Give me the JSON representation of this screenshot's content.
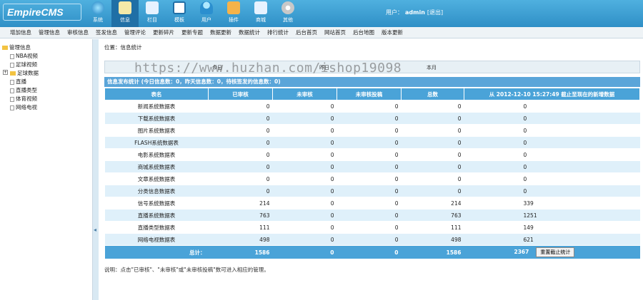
{
  "app": {
    "logo": "EmpireCMS"
  },
  "nav": [
    {
      "label": "系统",
      "icon": "globe-icon",
      "color": "#6fd0ff"
    },
    {
      "label": "信息",
      "icon": "document-edit-icon",
      "color": "#f5e9a8"
    },
    {
      "label": "栏目",
      "icon": "folder-icon",
      "color": "#e6f2ff"
    },
    {
      "label": "模板",
      "icon": "template-window-icon",
      "color": "#ffffff"
    },
    {
      "label": "用户",
      "icon": "user-icon",
      "color": "#6fd0ff"
    },
    {
      "label": "插件",
      "icon": "tools-icon",
      "color": "#f5b34a"
    },
    {
      "label": "商城",
      "icon": "shop-icon",
      "color": "#e6f2ff"
    },
    {
      "label": "其他",
      "icon": "gear-icon",
      "color": "#e0e0e0"
    }
  ],
  "user": {
    "label": "用户：",
    "name": "admin",
    "logout": "[退出]"
  },
  "toolbar": [
    "增加信息",
    "管理信息",
    "审核信息",
    "签发信息",
    "管理评论",
    "更新碎片",
    "更新专题",
    "数据更新",
    "数据统计",
    "排行统计",
    "后台首页",
    "网站首页",
    "后台地图",
    "版本更新"
  ],
  "tree": {
    "root": "管理信息",
    "items": [
      "NBA视频",
      "足球视频",
      "足球数据",
      "直播",
      "直播类型",
      "体育视频",
      "网络电视"
    ]
  },
  "location": "位置：信息统计",
  "tabs": [
    "今日",
    "昨日",
    "本月"
  ],
  "watermark": "https://www.huzhan.com/ishop19098",
  "stats_title": "信息发布统计 (今日信息数：0，昨天信息数：0，待核签发的信息数：0)",
  "table": {
    "headers": [
      "表名",
      "已审核",
      "未审核",
      "未审核投稿",
      "总数",
      "从 2012-12-10 15:27:49 截止至现在的新增数据"
    ],
    "rows": [
      [
        "新闻系统数据表",
        "0",
        "0",
        "0",
        "0",
        "0"
      ],
      [
        "下载系统数据表",
        "0",
        "0",
        "0",
        "0",
        "0"
      ],
      [
        "图片系统数据表",
        "0",
        "0",
        "0",
        "0",
        "0"
      ],
      [
        "FLASH系统数据表",
        "0",
        "0",
        "0",
        "0",
        "0"
      ],
      [
        "电影系统数据表",
        "0",
        "0",
        "0",
        "0",
        "0"
      ],
      [
        "商城系统数据表",
        "0",
        "0",
        "0",
        "0",
        "0"
      ],
      [
        "文章系统数据表",
        "0",
        "0",
        "0",
        "0",
        "0"
      ],
      [
        "分类信息数据表",
        "0",
        "0",
        "0",
        "0",
        "0"
      ],
      [
        "信号系统数据表",
        "214",
        "0",
        "0",
        "214",
        "339"
      ],
      [
        "直播系统数据表",
        "763",
        "0",
        "0",
        "763",
        "1251"
      ],
      [
        "直播类型数据表",
        "111",
        "0",
        "0",
        "111",
        "149"
      ],
      [
        "网络电视数据表",
        "498",
        "0",
        "0",
        "498",
        "621"
      ]
    ],
    "total": [
      "总计：",
      "1586",
      "0",
      "0",
      "1586",
      "2367"
    ],
    "reset_button": "重置截止统计"
  },
  "note": "说明：点击\"已审核\"、\"未审核\"或\"未审核投稿\"数可进入相应的管理。",
  "colors": {
    "header": "#3a9ed6",
    "table_header": "#4aa3d8",
    "row_alt": "#dff0fa"
  }
}
